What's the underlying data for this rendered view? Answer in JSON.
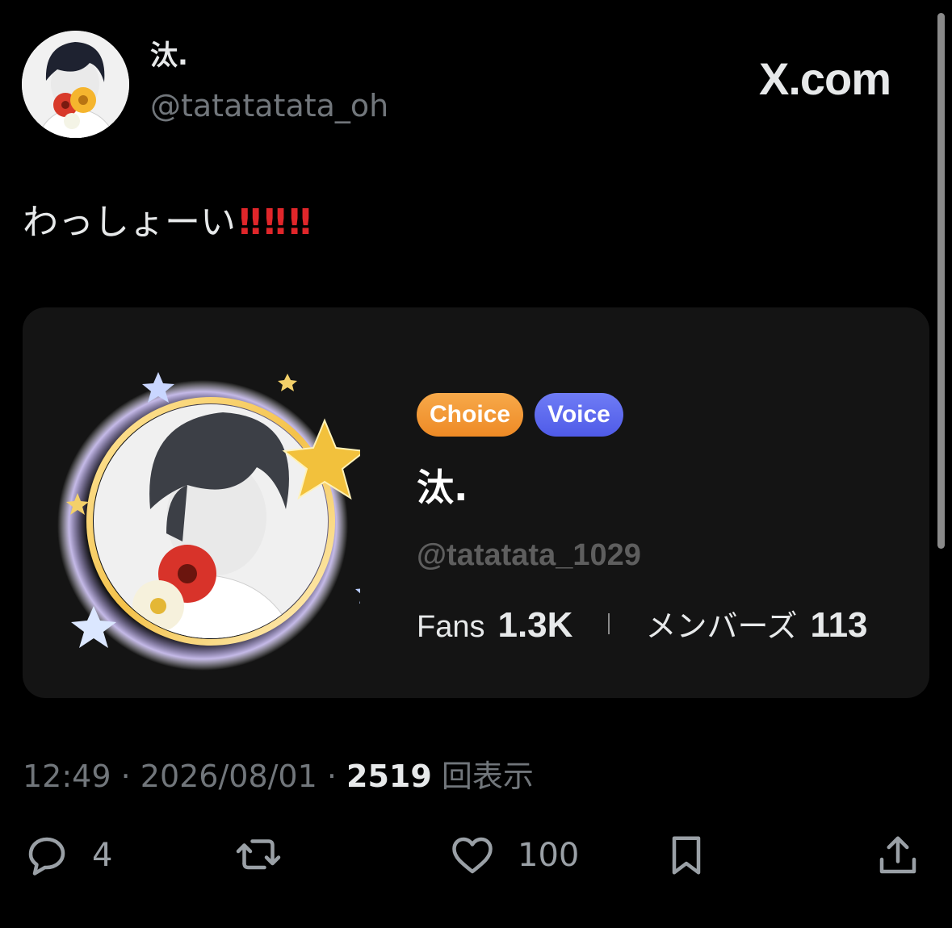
{
  "tweet": {
    "display_name": "汰.",
    "handle": "@tatatatata_oh",
    "text": "わっしょーい",
    "emphasis": "‼︎ ‼︎ ‼︎",
    "site_label": "X.com"
  },
  "card": {
    "badges": [
      "Choice",
      "Voice"
    ],
    "name": "汰.",
    "handle": "@tatatata_1029",
    "fans_label": "Fans",
    "fans_value": "1.3K",
    "members_label": "メンバーズ",
    "members_value": "113"
  },
  "meta": {
    "time": "12:49",
    "date": "2026/08/01",
    "views_count": "2519",
    "views_label": "回表示"
  },
  "actions": {
    "reply_count": "4",
    "like_count": "100"
  },
  "colors": {
    "background": "#000000",
    "card": "#141414",
    "choice_badge": "#f09a35",
    "voice_badge": "#5a66ee",
    "emphasis": "#e0262a"
  }
}
